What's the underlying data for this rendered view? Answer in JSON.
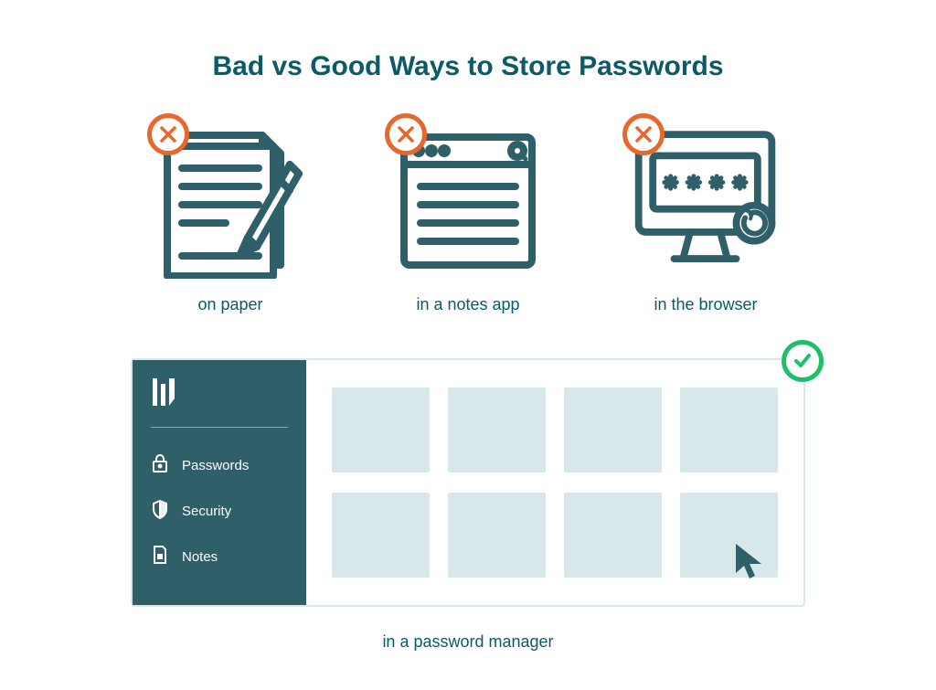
{
  "title": "Bad vs Good Ways to Store Passwords",
  "bad_options": [
    {
      "label": "on paper",
      "icon": "paper-pencil-icon"
    },
    {
      "label": "in a notes app",
      "icon": "notes-app-icon"
    },
    {
      "label": "in the browser",
      "icon": "browser-monitor-icon"
    }
  ],
  "good_option": {
    "label": "in a password manager",
    "sidebar_items": [
      {
        "label": "Passwords",
        "icon": "lock-icon"
      },
      {
        "label": "Security",
        "icon": "shield-icon"
      },
      {
        "label": "Notes",
        "icon": "note-file-icon"
      }
    ],
    "card_count": 8
  },
  "colors": {
    "primary": "#0c5a68",
    "sidebar": "#2f5f68",
    "bad": "#e8672c",
    "good": "#1dbf6c",
    "card": "#d7e7ea"
  }
}
